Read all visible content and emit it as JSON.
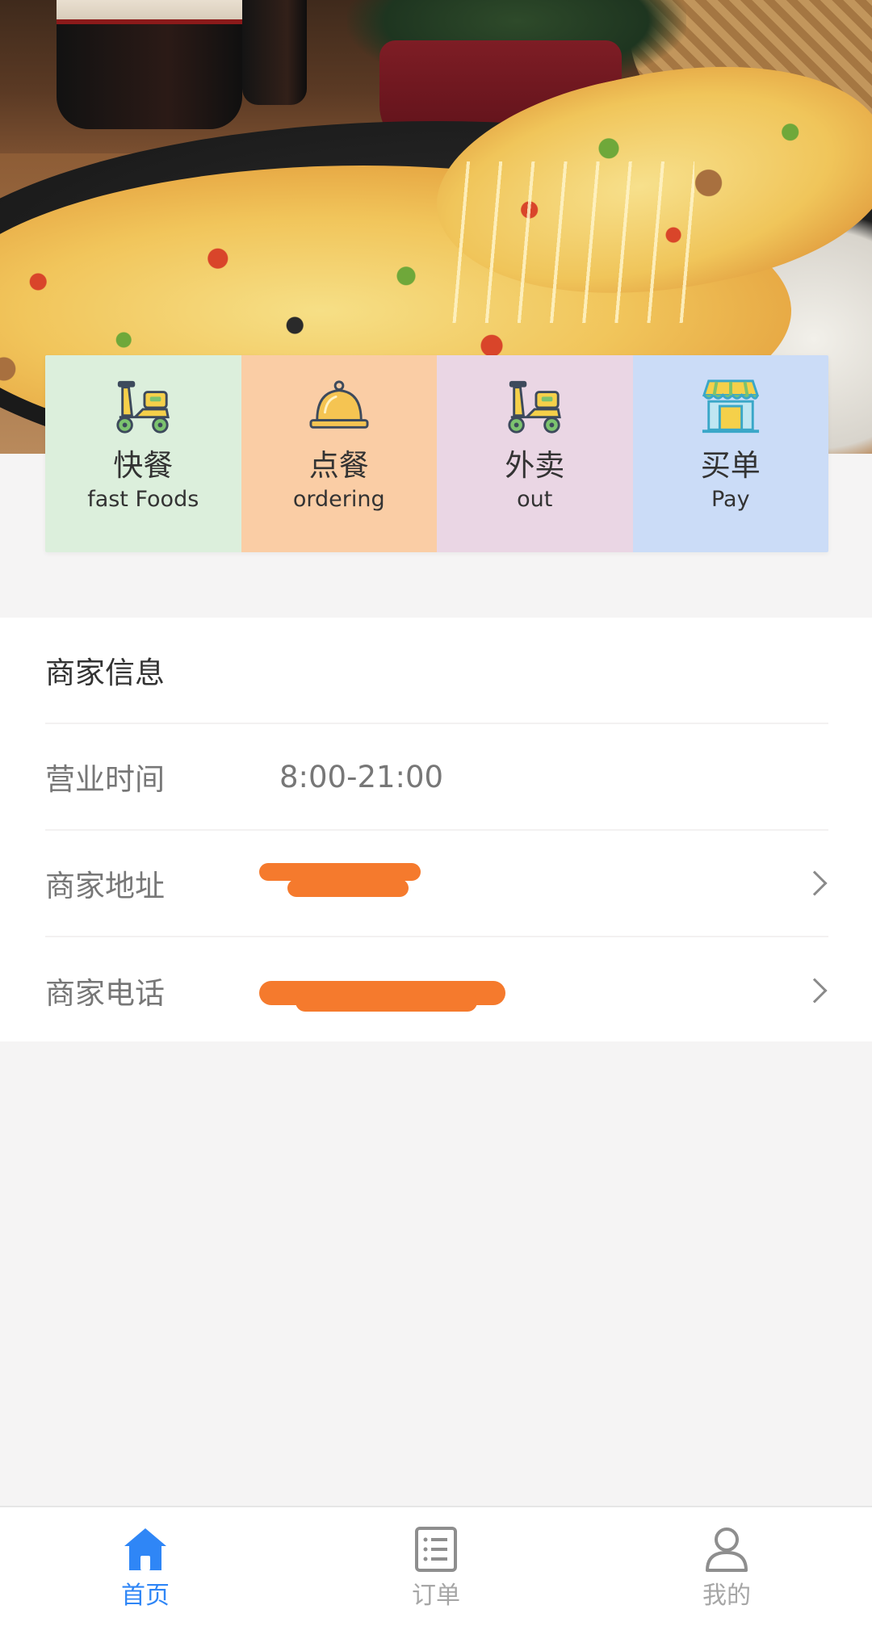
{
  "categories": [
    {
      "zh": "快餐",
      "en": "fast Foods",
      "icon": "scooter-icon",
      "bg": "#dcefdc"
    },
    {
      "zh": "点餐",
      "en": "ordering",
      "icon": "service-bell-icon",
      "bg": "#facda5"
    },
    {
      "zh": "外卖",
      "en": "out",
      "icon": "delivery-scooter-icon",
      "bg": "#ead6e4"
    },
    {
      "zh": "买单",
      "en": "Pay",
      "icon": "storefront-icon",
      "bg": "#cbdcf7"
    }
  ],
  "merchant_info": {
    "heading": "商家信息",
    "hours_label": "营业时间",
    "hours_value": "8:00-21:00",
    "address_label": "商家地址",
    "phone_label": "商家电话"
  },
  "tabbar": {
    "items": [
      {
        "label": "首页",
        "icon": "home-icon",
        "active": true
      },
      {
        "label": "订单",
        "icon": "order-list-icon",
        "active": false
      },
      {
        "label": "我的",
        "icon": "user-icon",
        "active": false
      }
    ]
  },
  "colors": {
    "accent": "#2f86f6",
    "tab_inactive": "#a6a6a6",
    "redaction": "#f57a2d",
    "page_bg": "#f5f4f4"
  }
}
